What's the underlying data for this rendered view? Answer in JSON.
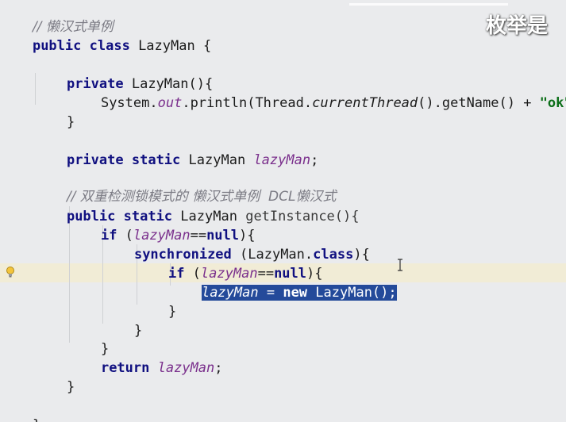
{
  "overlay": {
    "subtitle": "枚举是"
  },
  "code": {
    "comment1": "// 懒汉式单例",
    "l_public": "public",
    "l_class": "class",
    "l_classname": "LazyMan",
    "l_open": " {",
    "ctor_private": "private",
    "ctor_name": "LazyMan(){",
    "println_prefix": "System.",
    "println_out": "out",
    "println_mid": ".println(Thread.",
    "println_current": "currentThread",
    "println_tail": "().getName() + ",
    "println_str": "\"ok\"",
    "println_end": ");",
    "close_brace": "}",
    "field_private": "private",
    "field_static": "static",
    "field_type": "LazyMan",
    "field_name": "lazyMan",
    "semicolon": ";",
    "comment2": "// 双重检测锁模式的 懒汉式单例  DCL懒汉式",
    "gi_public": "public",
    "gi_static": "static",
    "gi_type": "LazyMan",
    "gi_name": "getInstance(){",
    "if_kw": "if",
    "if_open": " (",
    "if_cond": "==",
    "if_null": "null",
    "if_close": "){",
    "sync_kw": "synchronized",
    "sync_arg": " (LazyMan.",
    "sync_class": "class",
    "sync_close": "){",
    "assign_field": "lazyMan",
    "assign_rest": " = ",
    "assign_new": "new",
    "assign_ctor": " LazyMan();",
    "return_kw": "return",
    "return_field": "lazyMan"
  },
  "icons": {
    "gutter": "lightbulb-icon",
    "cursor": "text-cursor-icon"
  },
  "colors": {
    "background": "#eaebed",
    "keyword": "#101080",
    "field": "#7a2f8c",
    "string": "#0b6e18",
    "comment": "#7b7b84",
    "selection": "#244a9a",
    "current_line": "#f1ecd6"
  }
}
